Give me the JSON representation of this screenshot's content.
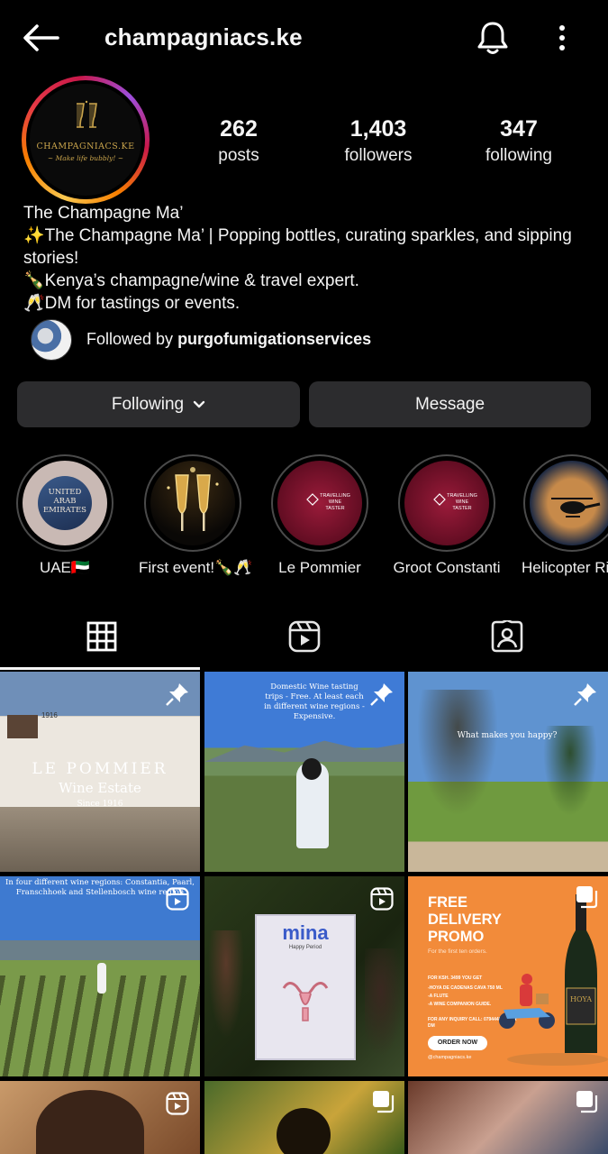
{
  "header": {
    "username": "champagniacs.ke"
  },
  "profile": {
    "avatar_brand": "CHAMPAGNIACS.KE",
    "avatar_tagline": "~ Make life bubbly! ~",
    "stats": [
      {
        "value": "262",
        "label": "posts"
      },
      {
        "value": "1,403",
        "label": "followers"
      },
      {
        "value": "347",
        "label": "following"
      }
    ],
    "name": "The Champagne Ma’",
    "bio_lines": [
      "✨The Champagne Ma’ | Popping bottles, curating sparkles, and sipping",
      "stories!",
      "🍾Kenya’s champagne/wine & travel expert.",
      "🥂DM for tastings or events."
    ],
    "followed_by_prefix": "Followed by ",
    "followed_by_user": "purgofumigationservices"
  },
  "actions": {
    "following_label": "Following",
    "message_label": "Message"
  },
  "highlights": [
    {
      "label": "UAE🇦🇪",
      "inner_text": "UNITED ARAB EMIRATES"
    },
    {
      "label": "First event!🍾🥂"
    },
    {
      "label": "Le Pommier",
      "inner_text": "TRAVELLING WINE TASTER"
    },
    {
      "label": "Groot Constanti",
      "inner_text": "TRAVELLING WINE TASTER"
    },
    {
      "label": "Helicopter Ri"
    }
  ],
  "tabs": [
    "posts-grid-icon",
    "reels-icon",
    "tagged-icon"
  ],
  "posts": [
    {
      "type": "pinned",
      "title": "LE POMMIER",
      "subtitle": "Wine Estate",
      "since": "Since 1916",
      "sign": "1916"
    },
    {
      "type": "pinned",
      "caption": "Domestic Wine tasting trips - Free. At least each in different wine regions - Expensive."
    },
    {
      "type": "pinned",
      "caption": "What makes you happy?"
    },
    {
      "type": "reel",
      "caption": "In four different wine regions: Constantia, Paarl, Franschhoek and Stellenbosch wine region"
    },
    {
      "type": "reel",
      "sign_brand": "mina",
      "sign_sub": "Happy Period"
    },
    {
      "type": "multi",
      "promo_title": [
        "FREE",
        "DELIVERY",
        "PROMO"
      ],
      "promo_sub": "For the first ten orders.",
      "promo_offer": "FOR KSH. 3499 YOU GET",
      "promo_items": [
        "-HOYA DE CADENAS CAVA 750 ML",
        "-A FLUTE",
        "-A WINE COMPANION GUIDE."
      ],
      "promo_contact": "FOR ANY INQUIRY CALL: 0794448108 OR DM",
      "promo_button": "ORDER NOW",
      "promo_handle": "@champagniacs.ke",
      "bottle_label": "HOYA"
    },
    {
      "type": "reel"
    },
    {
      "type": "multi"
    },
    {
      "type": "multi"
    }
  ],
  "colors": {
    "background": "#000000",
    "button": "#2c2c2e",
    "promo_orange": "#f28b3a",
    "gold": "#c9a44c"
  }
}
